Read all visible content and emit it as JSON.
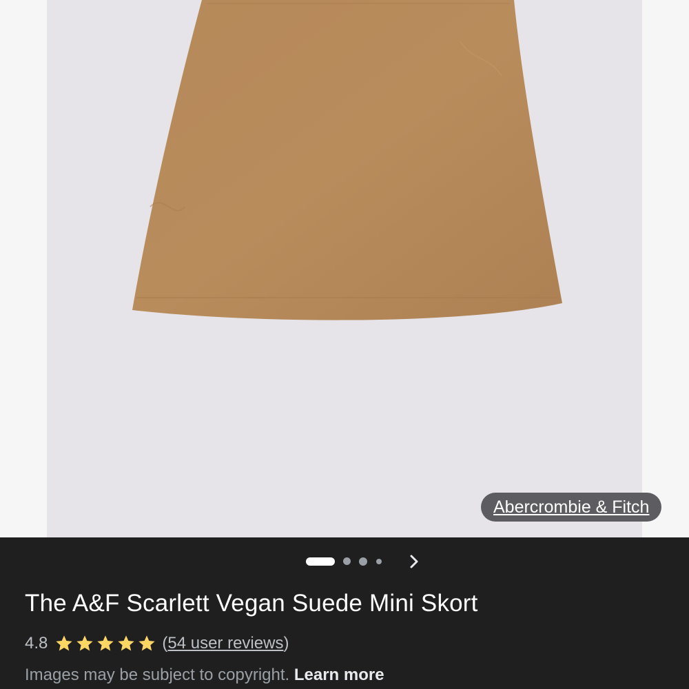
{
  "image": {
    "source_label": "Abercrombie & Fitch",
    "alt": "The A&F Scarlett Vegan Suede Mini Skort",
    "product_color": "#b98c5c",
    "background_color": "#e6e4e8"
  },
  "carousel": {
    "total_images": 4,
    "current_index": 0,
    "next_icon": "chevron-right-icon"
  },
  "product": {
    "title": "The A&F Scarlett Vegan Suede Mini Skort",
    "rating": "4.8",
    "stars_filled": 5,
    "stars_total": 5,
    "reviews_open": "(",
    "reviews_text": "54 user reviews",
    "reviews_close": ")",
    "star_color": "#fdd663"
  },
  "footer": {
    "disclaimer": "Images may be subject to copyright.",
    "learn_more": "Learn more"
  }
}
